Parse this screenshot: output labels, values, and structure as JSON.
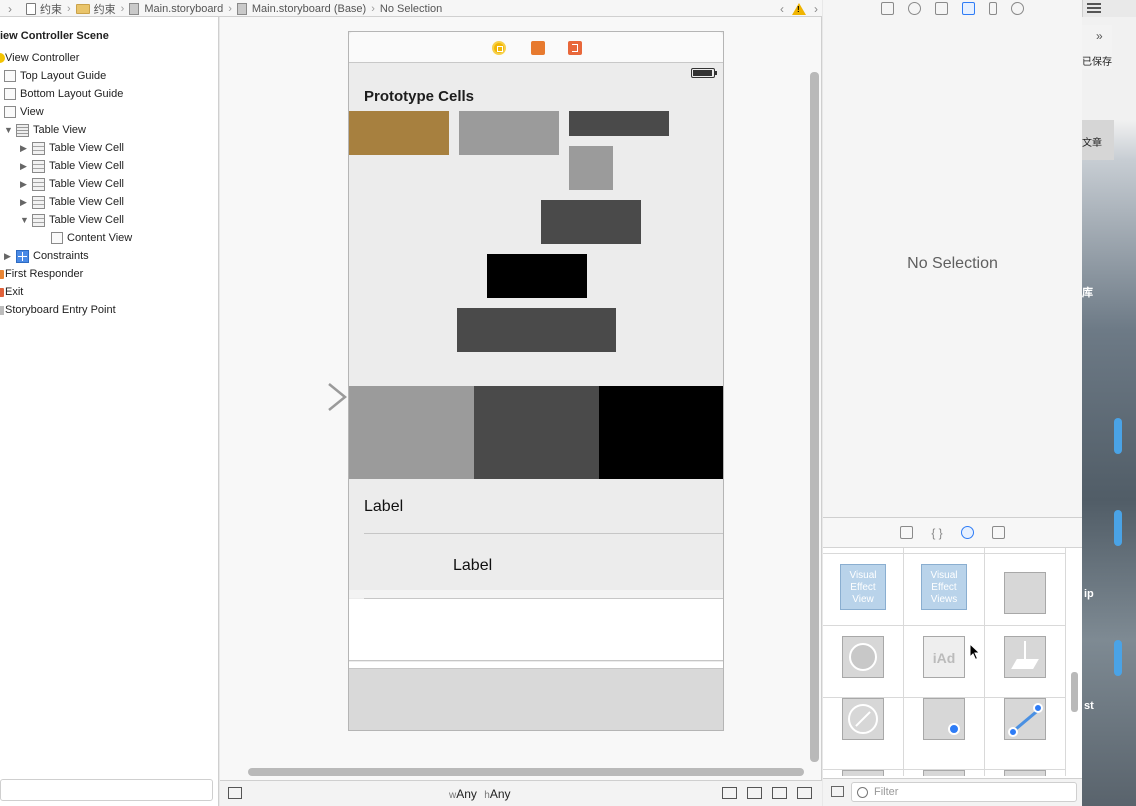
{
  "jumpbar": {
    "crumbs": [
      "约束",
      "约束",
      "Main.storyboard",
      "Main.storyboard (Base)",
      "No Selection"
    ]
  },
  "outline": {
    "scene_title": "iew Controller Scene",
    "items": [
      {
        "label": "View Controller"
      },
      {
        "label": "Top Layout Guide"
      },
      {
        "label": "Bottom Layout Guide"
      },
      {
        "label": "View"
      },
      {
        "label": "Table View"
      },
      {
        "label": "Table View Cell"
      },
      {
        "label": "Table View Cell"
      },
      {
        "label": "Table View Cell"
      },
      {
        "label": "Table View Cell"
      },
      {
        "label": "Table View Cell"
      },
      {
        "label": "Content View"
      },
      {
        "label": "Constraints"
      },
      {
        "label": "First Responder"
      },
      {
        "label": "Exit"
      },
      {
        "label": "Storyboard Entry Point"
      }
    ]
  },
  "canvas": {
    "prototype_title": "Prototype Cells",
    "label_1": "Label",
    "label_2": "Label",
    "size_class": {
      "w_prefix": "w",
      "w_value": "Any",
      "h_prefix": "h",
      "h_value": "Any"
    }
  },
  "colors": {
    "gold": "#A7803F",
    "mid_gray": "#9B9B9B",
    "dark_gray": "#4A4A4A",
    "black": "#000000",
    "accent": "#2E7CF6"
  },
  "inspector": {
    "no_selection": "No Selection"
  },
  "library": {
    "filter_placeholder": "Filter",
    "items": [
      {
        "text": "Visual Effect View"
      },
      {
        "text": "Visual Effect Views"
      },
      {
        "text": ""
      },
      {
        "text": ""
      },
      {
        "text": "iAd"
      },
      {
        "text": ""
      },
      {
        "text": ""
      },
      {
        "text": ""
      },
      {
        "text": ""
      }
    ]
  },
  "desktop": {
    "saved": "已保存",
    "article": "文章",
    "ku": "库",
    "ip": "ip",
    "st": "st"
  }
}
